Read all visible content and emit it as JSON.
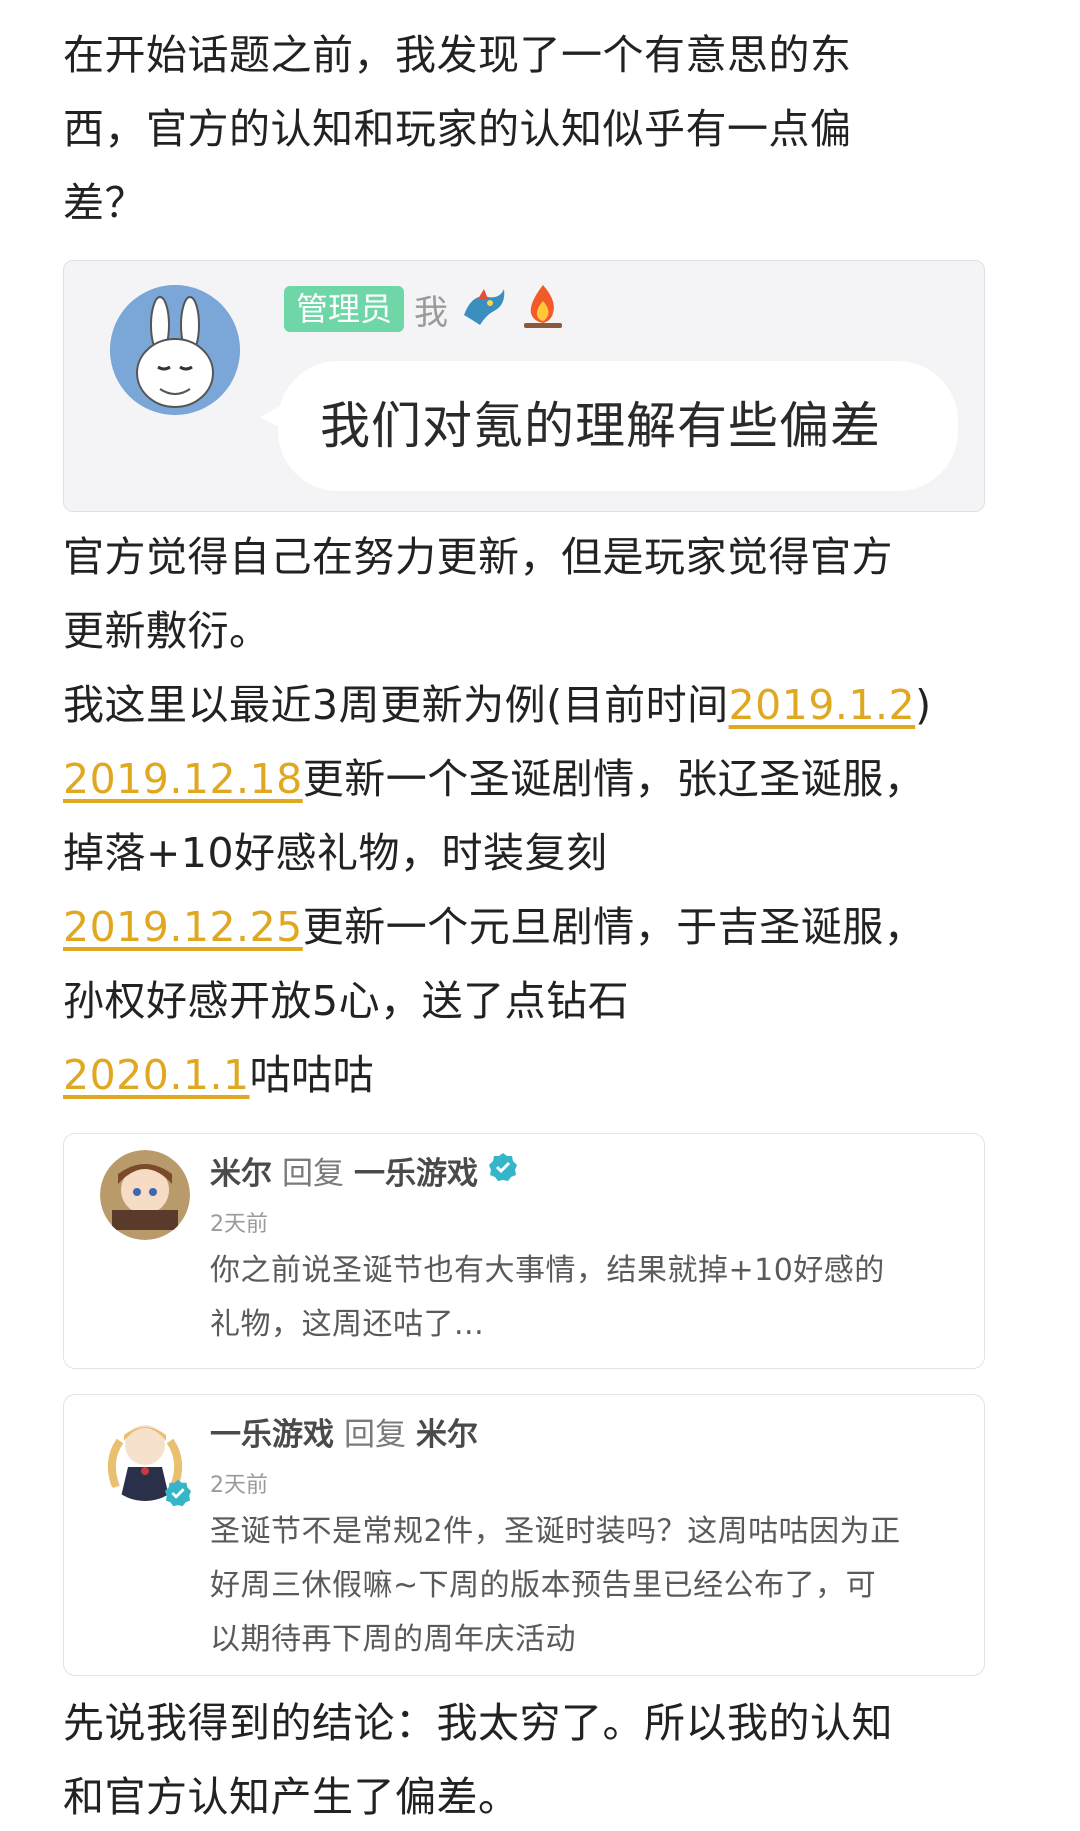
{
  "intro": {
    "line1": "在开始话题之前，我发现了一个有意思的东",
    "line2": "西，官方的认知和玩家的认知似乎有一点偏",
    "line3": "差？"
  },
  "chat": {
    "badge": "管理员",
    "name": "我",
    "message": "我们对氪的理解有些偏差"
  },
  "para2": {
    "line1": "官方觉得自己在努力更新，但是玩家觉得官方",
    "line2": "更新敷衍。"
  },
  "timeline": {
    "intro_prefix": "我这里以最近3周更新为例(目前时间",
    "current_date": "2019.1.2",
    "intro_suffix": ")",
    "entry1_date": "2019.12.18",
    "entry1_text": "更新一个圣诞剧情，张辽圣诞服，",
    "entry1_text2": "掉落+10好感礼物，时装复刻",
    "entry2_date": "2019.12.25",
    "entry2_text": "更新一个元旦剧情，于吉圣诞服，",
    "entry2_text2": "孙权好感开放5心，送了点钻石",
    "entry3_date": "2020.1.1",
    "entry3_text": "咕咕咕"
  },
  "comments": [
    {
      "user": "米尔",
      "reply_word": "回复",
      "target": "一乐游戏",
      "time": "2天前",
      "line1": "你之前说圣诞节也有大事情，结果就掉+10好感的",
      "line2": "礼物，这周还咕了..."
    },
    {
      "user": "一乐游戏",
      "reply_word": "回复",
      "target": "米尔",
      "time": "2天前",
      "line1": "圣诞节不是常规2件，圣诞时装吗？这周咕咕因为正",
      "line2": "好周三休假嘛~下周的版本预告里已经公布了，可",
      "line3": "以期待再下周的周年庆活动"
    }
  ],
  "conclusion": {
    "line1": "先说我得到的结论：我太穷了。所以我的认知",
    "line2": "和官方认知产生了偏差。"
  },
  "colors": {
    "date_link": "#e0a820",
    "admin_badge": "#6ed6a7",
    "verified": "#35b5c8"
  },
  "icons": [
    "rabbit-avatar-icon",
    "dragon-icon",
    "fire-icon",
    "verified-icon"
  ]
}
